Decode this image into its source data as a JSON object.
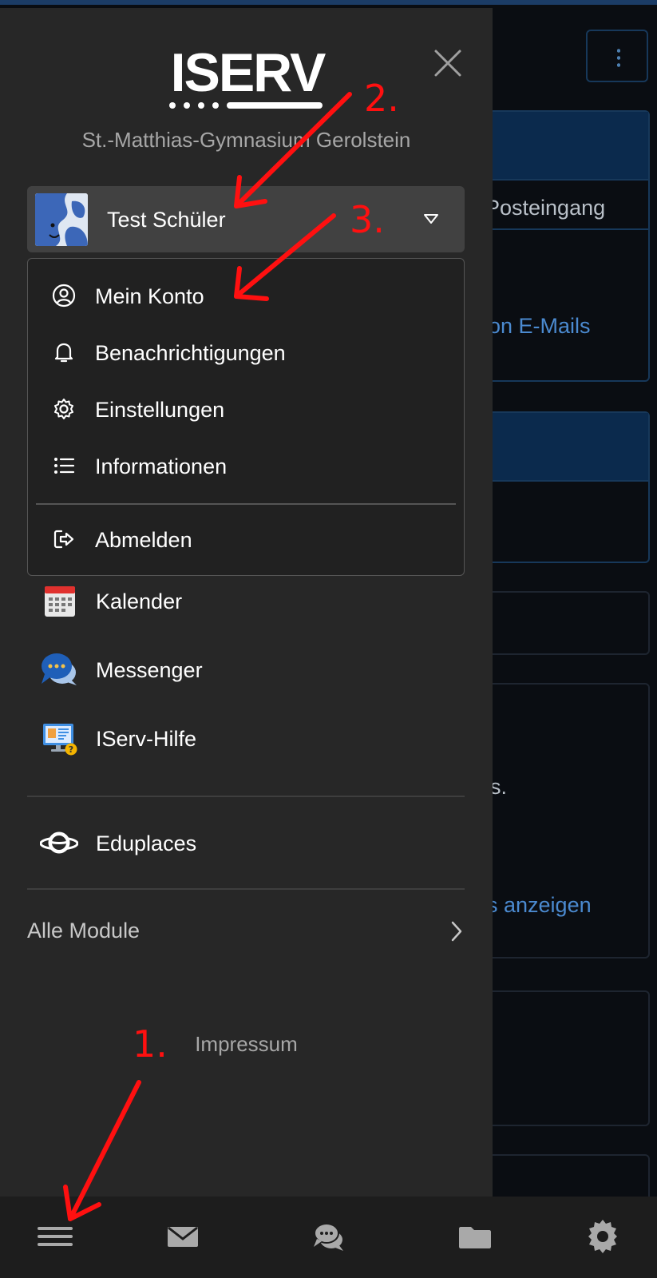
{
  "drawer": {
    "logo_text": "ISERV",
    "school_name": "St.-Matthias-Gymnasium Gerolstein",
    "user": {
      "name": "Test Schüler"
    },
    "user_menu": [
      {
        "label": "Mein Konto",
        "icon": "user-circle-icon"
      },
      {
        "label": "Benachrichtigungen",
        "icon": "bell-icon"
      },
      {
        "label": "Einstellungen",
        "icon": "gear-icon"
      },
      {
        "label": "Informationen",
        "icon": "list-icon"
      },
      {
        "label": "Abmelden",
        "icon": "logout-icon"
      }
    ],
    "modules": [
      {
        "label": "Kalender",
        "icon": "calendar-icon"
      },
      {
        "label": "Messenger",
        "icon": "messenger-icon"
      },
      {
        "label": "IServ-Hilfe",
        "icon": "help-icon"
      }
    ],
    "eduplaces": {
      "label": "Eduplaces",
      "icon": "planet-icon"
    },
    "all_modules": "Alle Module",
    "impressum": "Impressum"
  },
  "background": {
    "posteingang": "Posteingang",
    "emails_link": "on E-Mails",
    "stray_text": "s.",
    "anzeigen_link": "s anzeigen"
  },
  "bottom_bar": [
    {
      "name": "menu",
      "icon": "hamburger-icon"
    },
    {
      "name": "mail",
      "icon": "mail-icon"
    },
    {
      "name": "messenger",
      "icon": "chat-icon"
    },
    {
      "name": "files",
      "icon": "folder-icon"
    },
    {
      "name": "settings",
      "icon": "gear-icon"
    }
  ],
  "annotations": {
    "step1": "1.",
    "step2": "2.",
    "step3": "3."
  },
  "colors": {
    "drawer_bg": "#272727",
    "accent_blue": "#4b8ad0",
    "annotation_red": "#ff1010"
  }
}
